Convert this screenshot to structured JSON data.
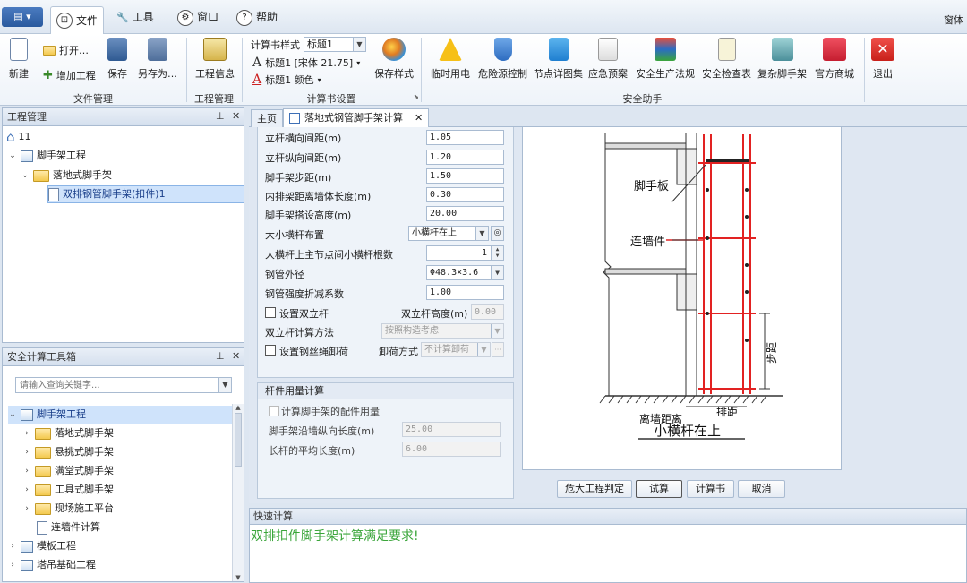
{
  "menubar": {
    "app_button": "▤ ▾",
    "tabs": [
      {
        "label": "文件",
        "icon": "⊡"
      },
      {
        "label": "工具",
        "icon": "🔧"
      },
      {
        "label": "窗口",
        "icon": "⚙"
      },
      {
        "label": "帮助",
        "icon": "?"
      }
    ],
    "right_text": "窗体"
  },
  "ribbon": {
    "file": {
      "new": "新建",
      "open": "打开…",
      "add_project": "增加工程",
      "save": "保存",
      "save_as": "另存为…",
      "group": "文件管理"
    },
    "project": {
      "info": "工程信息",
      "group": "工程管理"
    },
    "calcbook": {
      "style_label": "计算书样式",
      "style_value": "标题1",
      "font_line": "标题1 [宋体 21.75]",
      "color_line": "标题1 颜色",
      "save_style": "保存样式",
      "group": "计算书设置"
    },
    "safety": {
      "items": [
        "临时用电",
        "危险源控制",
        "节点详图集",
        "应急预案",
        "安全生产法规",
        "安全检查表",
        "复杂脚手架",
        "官方商城"
      ],
      "group": "安全助手"
    },
    "exit": "退出"
  },
  "project_panel": {
    "title": "工程管理",
    "pin": "ᵖ",
    "close": "✕",
    "tree": [
      {
        "label": "11"
      },
      {
        "label": "脚手架工程"
      },
      {
        "label": "落地式脚手架"
      },
      {
        "label": "双排钢管脚手架(扣件)1"
      }
    ]
  },
  "toolbox_panel": {
    "title": "安全计算工具箱",
    "pin": "ᵖ",
    "close": "✕",
    "search_placeholder": "请输入查询关键字...",
    "tree": [
      {
        "label": "脚手架工程"
      },
      {
        "label": "落地式脚手架"
      },
      {
        "label": "悬挑式脚手架"
      },
      {
        "label": "满堂式脚手架"
      },
      {
        "label": "工具式脚手架"
      },
      {
        "label": "现场施工平台"
      },
      {
        "label": "连墙件计算"
      },
      {
        "label": "模板工程"
      },
      {
        "label": "塔吊基础工程"
      }
    ]
  },
  "tabs": {
    "home": "主页",
    "doc": "落地式钢管脚手架计算",
    "close": "✕"
  },
  "form": {
    "fields": [
      {
        "label": "立杆横向间距(m)",
        "value": "1.05"
      },
      {
        "label": "立杆纵向间距(m)",
        "value": "1.20"
      },
      {
        "label": "脚手架步距(m)",
        "value": "1.50"
      },
      {
        "label": "内排架距离墙体长度(m)",
        "value": "0.30"
      },
      {
        "label": "脚手架搭设高度(m)",
        "value": "20.00"
      }
    ],
    "crossbar_label": "大小横杆布置",
    "crossbar_value": "小横杆在上",
    "count_label": "大横杆上主节点间小横杆根数",
    "count_value": "1",
    "pipe_label": "钢管外径",
    "pipe_value": "Φ48.3×3.6",
    "strength_label": "钢管强度折减系数",
    "strength_value": "1.00",
    "double_pole_label": "设置双立杆",
    "double_height_label": "双立杆高度(m)",
    "double_height_value": "0.00",
    "double_method_label": "双立杆计算方法",
    "double_method_value": "按照构造考虑",
    "wire_label": "设置钢丝绳卸荷",
    "unload_label": "卸荷方式",
    "unload_value": "不计算卸荷"
  },
  "usage": {
    "title": "杆件用量计算",
    "check_label": "计算脚手架的配件用量",
    "length_label": "脚手架沿墙纵向长度(m)",
    "length_value": "25.00",
    "avg_label": "长杆的平均长度(m)",
    "avg_value": "6.00"
  },
  "diagram": {
    "board": "脚手板",
    "tie": "连墙件",
    "step": "步距",
    "wall_dist": "离墙距离",
    "row_dist": "排距",
    "caption": "小横杆在上"
  },
  "buttons": {
    "judge": "危大工程判定",
    "trial": "试算",
    "book": "计算书",
    "cancel": "取消"
  },
  "quick": {
    "title": "快速计算",
    "message": "双排扣件脚手架计算满足要求!"
  },
  "colors": {
    "accent": "#3d6fb6",
    "selected": "#cfe3fb",
    "success": "#3aa53a",
    "scaffold": "#e22222"
  }
}
